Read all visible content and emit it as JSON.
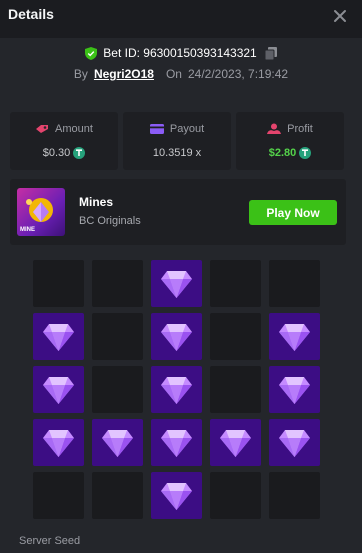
{
  "header": {
    "title": "Details"
  },
  "bet": {
    "id_label": "Bet ID: 96300150393143321",
    "by_label": "By",
    "user": "Negri2O18",
    "on_label": "On",
    "date": "24/2/2023, 7:19:42"
  },
  "stats": {
    "amount": {
      "label": "Amount",
      "value": "$0.30"
    },
    "payout": {
      "label": "Payout",
      "value": "10.3519 x"
    },
    "profit": {
      "label": "Profit",
      "value": "$2.80"
    }
  },
  "game": {
    "name": "Mines",
    "provider": "BC Originals",
    "play_label": "Play Now",
    "thumb_text": "MINE"
  },
  "board": {
    "rows": 5,
    "cols": 5,
    "cells": [
      0,
      0,
      1,
      0,
      0,
      1,
      0,
      1,
      0,
      1,
      1,
      0,
      1,
      0,
      1,
      1,
      1,
      1,
      1,
      1,
      0,
      0,
      1,
      0,
      0
    ]
  },
  "footer": {
    "server_seed_label": "Server Seed"
  },
  "colors": {
    "accent_green": "#3bc117",
    "profit_green": "#54d24a",
    "gem_tile": "#3c0d84",
    "empty_tile": "#1a1b1e"
  }
}
